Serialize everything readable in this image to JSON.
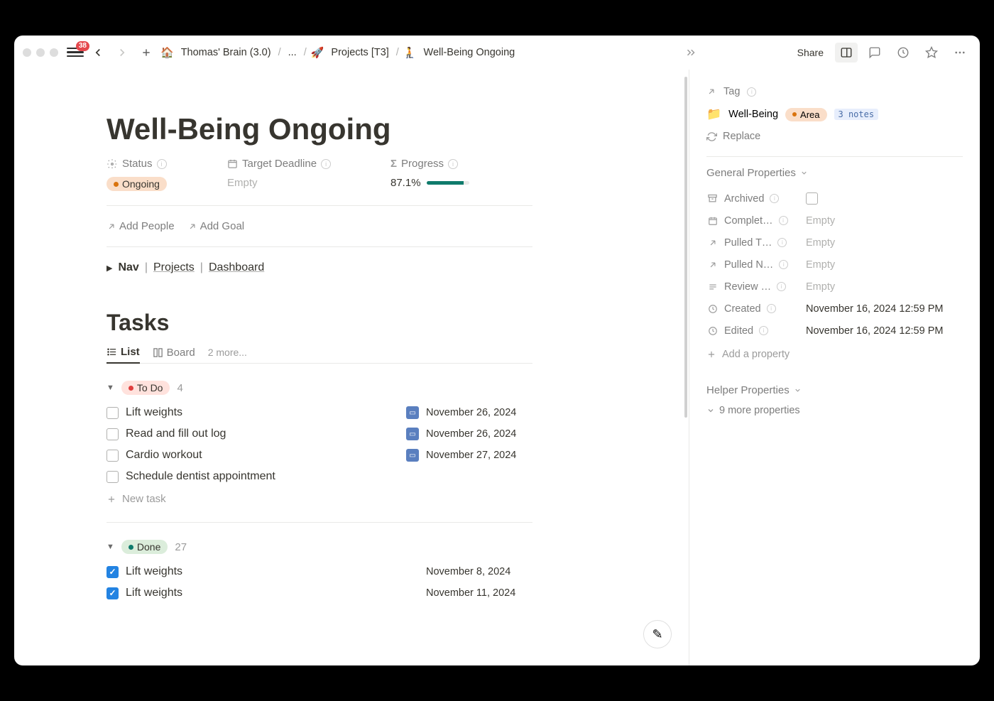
{
  "topbar": {
    "badge": "38",
    "breadcrumb": {
      "root_icon": "🏠",
      "root": "Thomas' Brain (3.0)",
      "ellipsis": "...",
      "projects_icon": "🚀",
      "projects": "Projects [T3]",
      "current_icon": "🧎",
      "current": "Well-Being Ongoing"
    },
    "share_label": "Share"
  },
  "page": {
    "title": "Well-Being Ongoing",
    "props": {
      "status_label": "Status",
      "status_value": "Ongoing",
      "deadline_label": "Target Deadline",
      "deadline_value": "Empty",
      "progress_label": "Progress",
      "progress_value": "87.1%",
      "progress_pct": 87.1
    },
    "actions": {
      "add_people": "Add People",
      "add_goal": "Add Goal"
    },
    "nav": {
      "label": "Nav",
      "projects": "Projects",
      "dashboard": "Dashboard"
    }
  },
  "tasks": {
    "heading": "Tasks",
    "views": {
      "list": "List",
      "board": "Board",
      "more": "2 more..."
    },
    "groups": [
      {
        "name": "To Do",
        "count": "4",
        "kind": "todo",
        "items": [
          {
            "title": "Lift weights",
            "date": "November 26, 2024",
            "icon": true,
            "checked": false
          },
          {
            "title": "Read and fill out log",
            "date": "November 26, 2024",
            "icon": true,
            "checked": false
          },
          {
            "title": "Cardio workout",
            "date": "November 27, 2024",
            "icon": true,
            "checked": false
          },
          {
            "title": "Schedule dentist appointment",
            "date": "",
            "icon": false,
            "checked": false
          }
        ],
        "new_task_label": "New task"
      },
      {
        "name": "Done",
        "count": "27",
        "kind": "done",
        "items": [
          {
            "title": "Lift weights",
            "date": "November 8, 2024",
            "icon": false,
            "checked": true
          },
          {
            "title": "Lift weights",
            "date": "November 11, 2024",
            "icon": false,
            "checked": true
          }
        ]
      }
    ]
  },
  "sidebar": {
    "tag_label": "Tag",
    "tag_value": "Well-Being",
    "tag_type": "Area",
    "tag_notes": "3 notes",
    "replace_label": "Replace",
    "general_heading": "General Properties",
    "rows": [
      {
        "icon": "archive",
        "label": "Archived",
        "value": "",
        "checkbox": true
      },
      {
        "icon": "date",
        "label": "Complet…",
        "value": "Empty"
      },
      {
        "icon": "link",
        "label": "Pulled T…",
        "value": "Empty"
      },
      {
        "icon": "link",
        "label": "Pulled N…",
        "value": "Empty"
      },
      {
        "icon": "text",
        "label": "Review …",
        "value": "Empty"
      },
      {
        "icon": "clock",
        "label": "Created",
        "value": "November 16, 2024 12:59 PM"
      },
      {
        "icon": "clock",
        "label": "Edited",
        "value": "November 16, 2024 12:59 PM"
      }
    ],
    "add_property": "Add a property",
    "helper_heading": "Helper Properties",
    "more_props": "9 more properties"
  }
}
